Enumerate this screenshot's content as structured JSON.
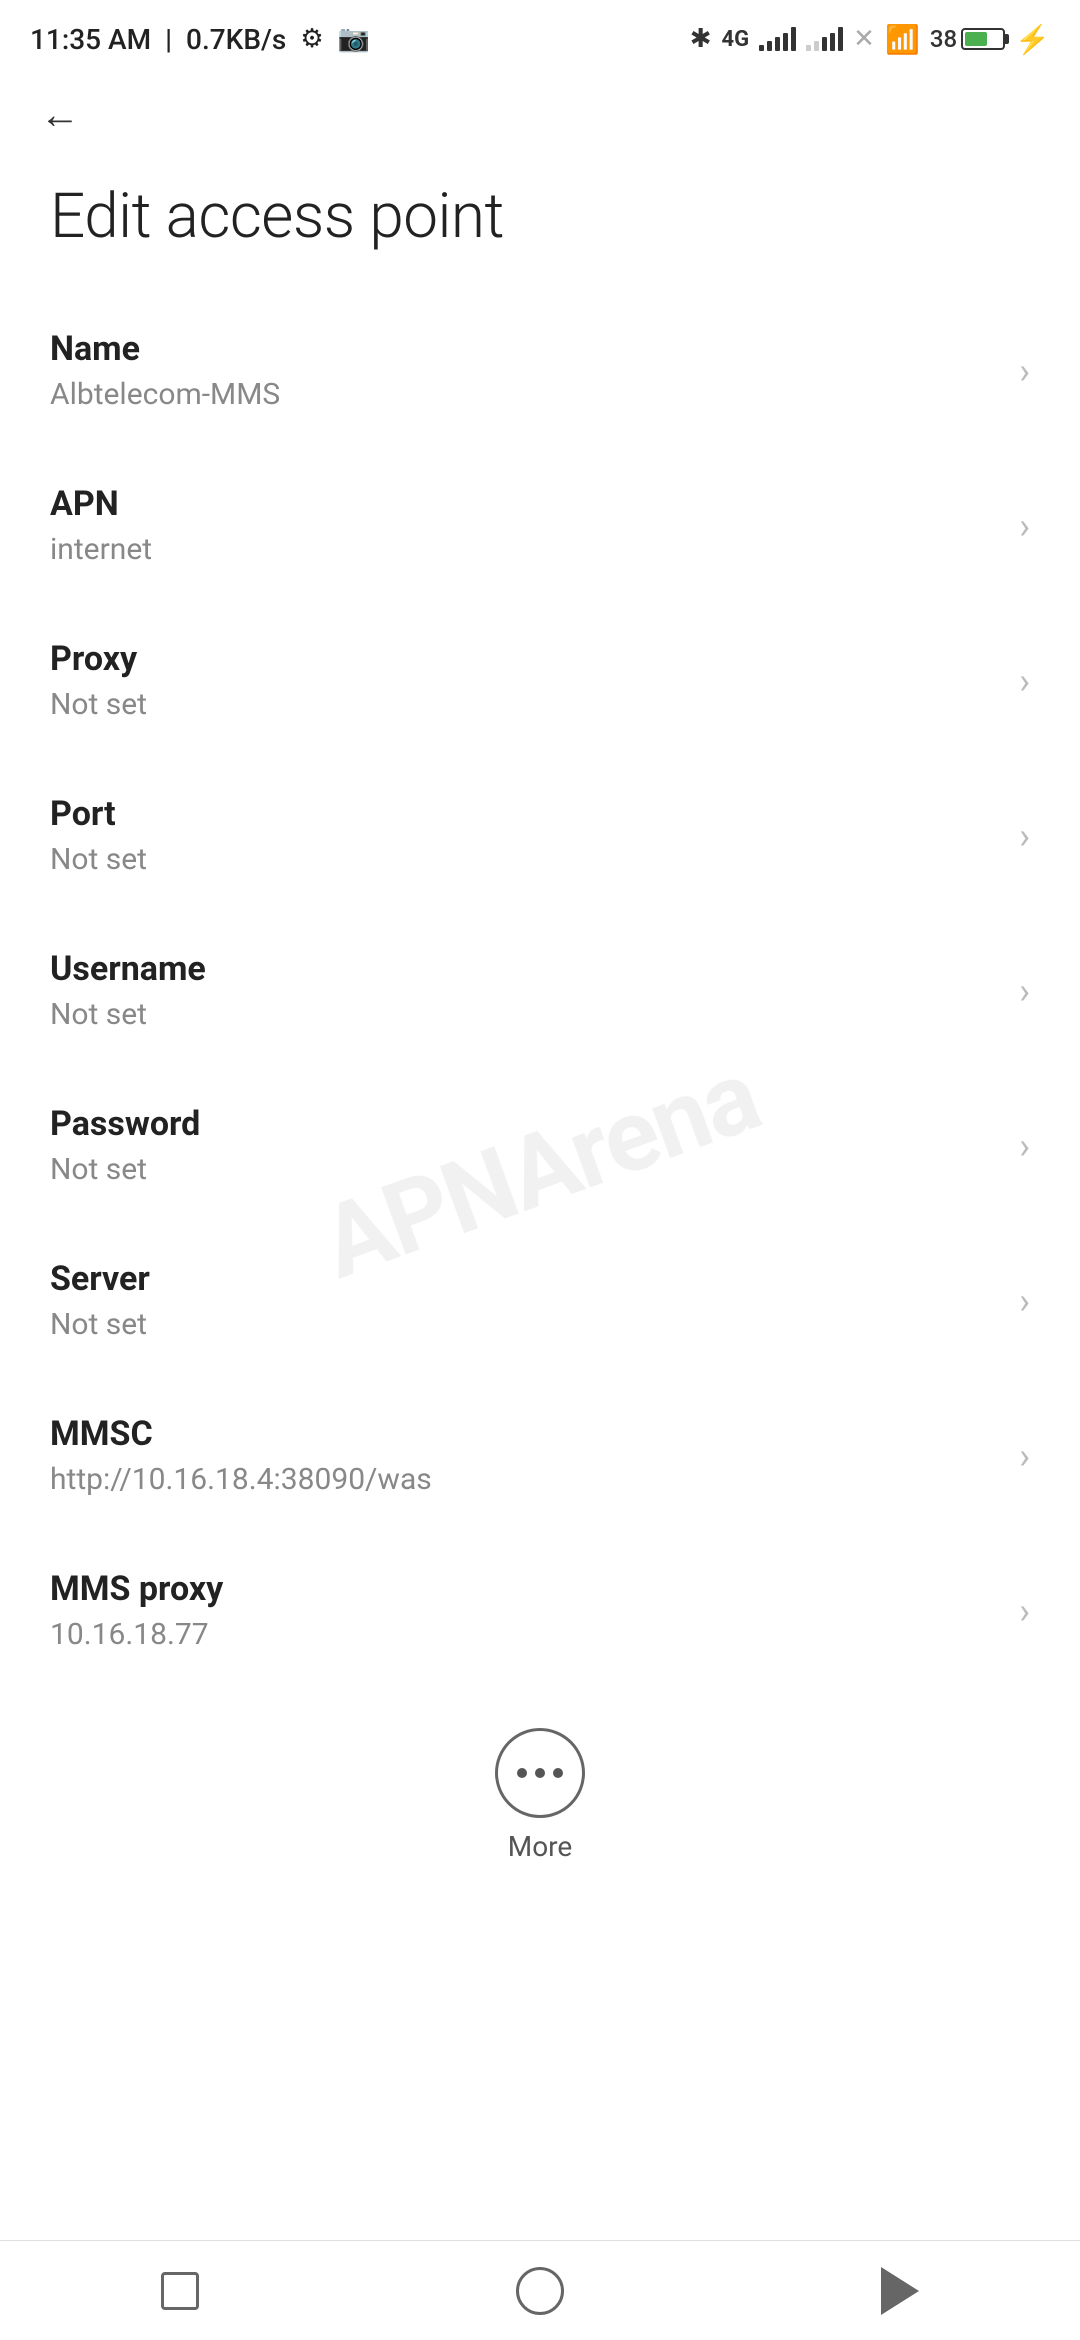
{
  "statusBar": {
    "time": "11:35 AM",
    "speed": "0.7KB/s"
  },
  "toolbar": {
    "backLabel": "←"
  },
  "page": {
    "title": "Edit access point"
  },
  "fields": [
    {
      "id": "name",
      "label": "Name",
      "value": "Albtelecom-MMS"
    },
    {
      "id": "apn",
      "label": "APN",
      "value": "internet"
    },
    {
      "id": "proxy",
      "label": "Proxy",
      "value": "Not set"
    },
    {
      "id": "port",
      "label": "Port",
      "value": "Not set"
    },
    {
      "id": "username",
      "label": "Username",
      "value": "Not set"
    },
    {
      "id": "password",
      "label": "Password",
      "value": "Not set"
    },
    {
      "id": "server",
      "label": "Server",
      "value": "Not set"
    },
    {
      "id": "mmsc",
      "label": "MMSC",
      "value": "http://10.16.18.4:38090/was"
    },
    {
      "id": "mms-proxy",
      "label": "MMS proxy",
      "value": "10.16.18.77"
    }
  ],
  "more": {
    "label": "More"
  },
  "watermark": "APNArena",
  "bottomNav": {
    "squareLabel": "recent-apps",
    "circleLabel": "home",
    "triangleLabel": "back"
  }
}
